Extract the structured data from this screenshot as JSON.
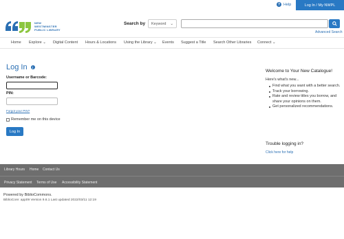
{
  "header": {
    "help_label": "Help",
    "help_icon": "help-circle-icon",
    "login_label": "Log In / My NWPL",
    "logo": {
      "line1": "NEW WESTMINSTER",
      "line2": "PUBLIC LIBRARY",
      "icon": "quote-marks-logo-icon",
      "colors": [
        "#2a6fb3",
        "#8cc63f"
      ]
    }
  },
  "search": {
    "label": "Search by",
    "type_value": "Keyword",
    "input_value": "",
    "button_icon": "search-icon",
    "advanced_label": "Advanced Search"
  },
  "nav": {
    "items": [
      {
        "label": "Home",
        "dropdown": false
      },
      {
        "label": "Explore",
        "dropdown": true
      },
      {
        "label": "Digital Content",
        "dropdown": false
      },
      {
        "label": "Hours & Locations",
        "dropdown": false
      },
      {
        "label": "Using the Library",
        "dropdown": true
      },
      {
        "label": "Events",
        "dropdown": false
      },
      {
        "label": "Suggest a Title",
        "dropdown": false
      },
      {
        "label": "Search Other Libraries",
        "dropdown": false
      },
      {
        "label": "Connect",
        "dropdown": true
      }
    ]
  },
  "login": {
    "title": "Log In",
    "username_label": "Username or Barcode:",
    "username_value": "",
    "pin_label": "PIN:",
    "pin_value": "",
    "forgot_label": "Forgot your PIN?",
    "remember_label": "Remember me on this device",
    "remember_checked": false,
    "submit_label": "Log In"
  },
  "welcome": {
    "title": "Welcome to Your New Catalogue!",
    "intro": "Here's what's new...",
    "items": [
      "Find what you want with a better search.",
      "Track your borrowing.",
      "Rate and review titles you borrow, and share your opinions on them.",
      "Get personalized recommendations."
    ]
  },
  "trouble": {
    "title": "Trouble logging in?",
    "link": "Click here for help"
  },
  "footer": {
    "row1": [
      "Library Hours",
      "Home",
      "Contact Us"
    ],
    "row2": [
      "Privacy Statement",
      "Terms of Use",
      "Accessibility Statement"
    ],
    "powered": "Powered by BiblioCommons.",
    "version": "BiblioCore: app09 Version 9.6.1 Last updated 2022/03/11 12:19"
  },
  "colors": {
    "accent": "#2979c4",
    "link": "#2a6fb3",
    "footer_bg": "#6e6e6e"
  }
}
